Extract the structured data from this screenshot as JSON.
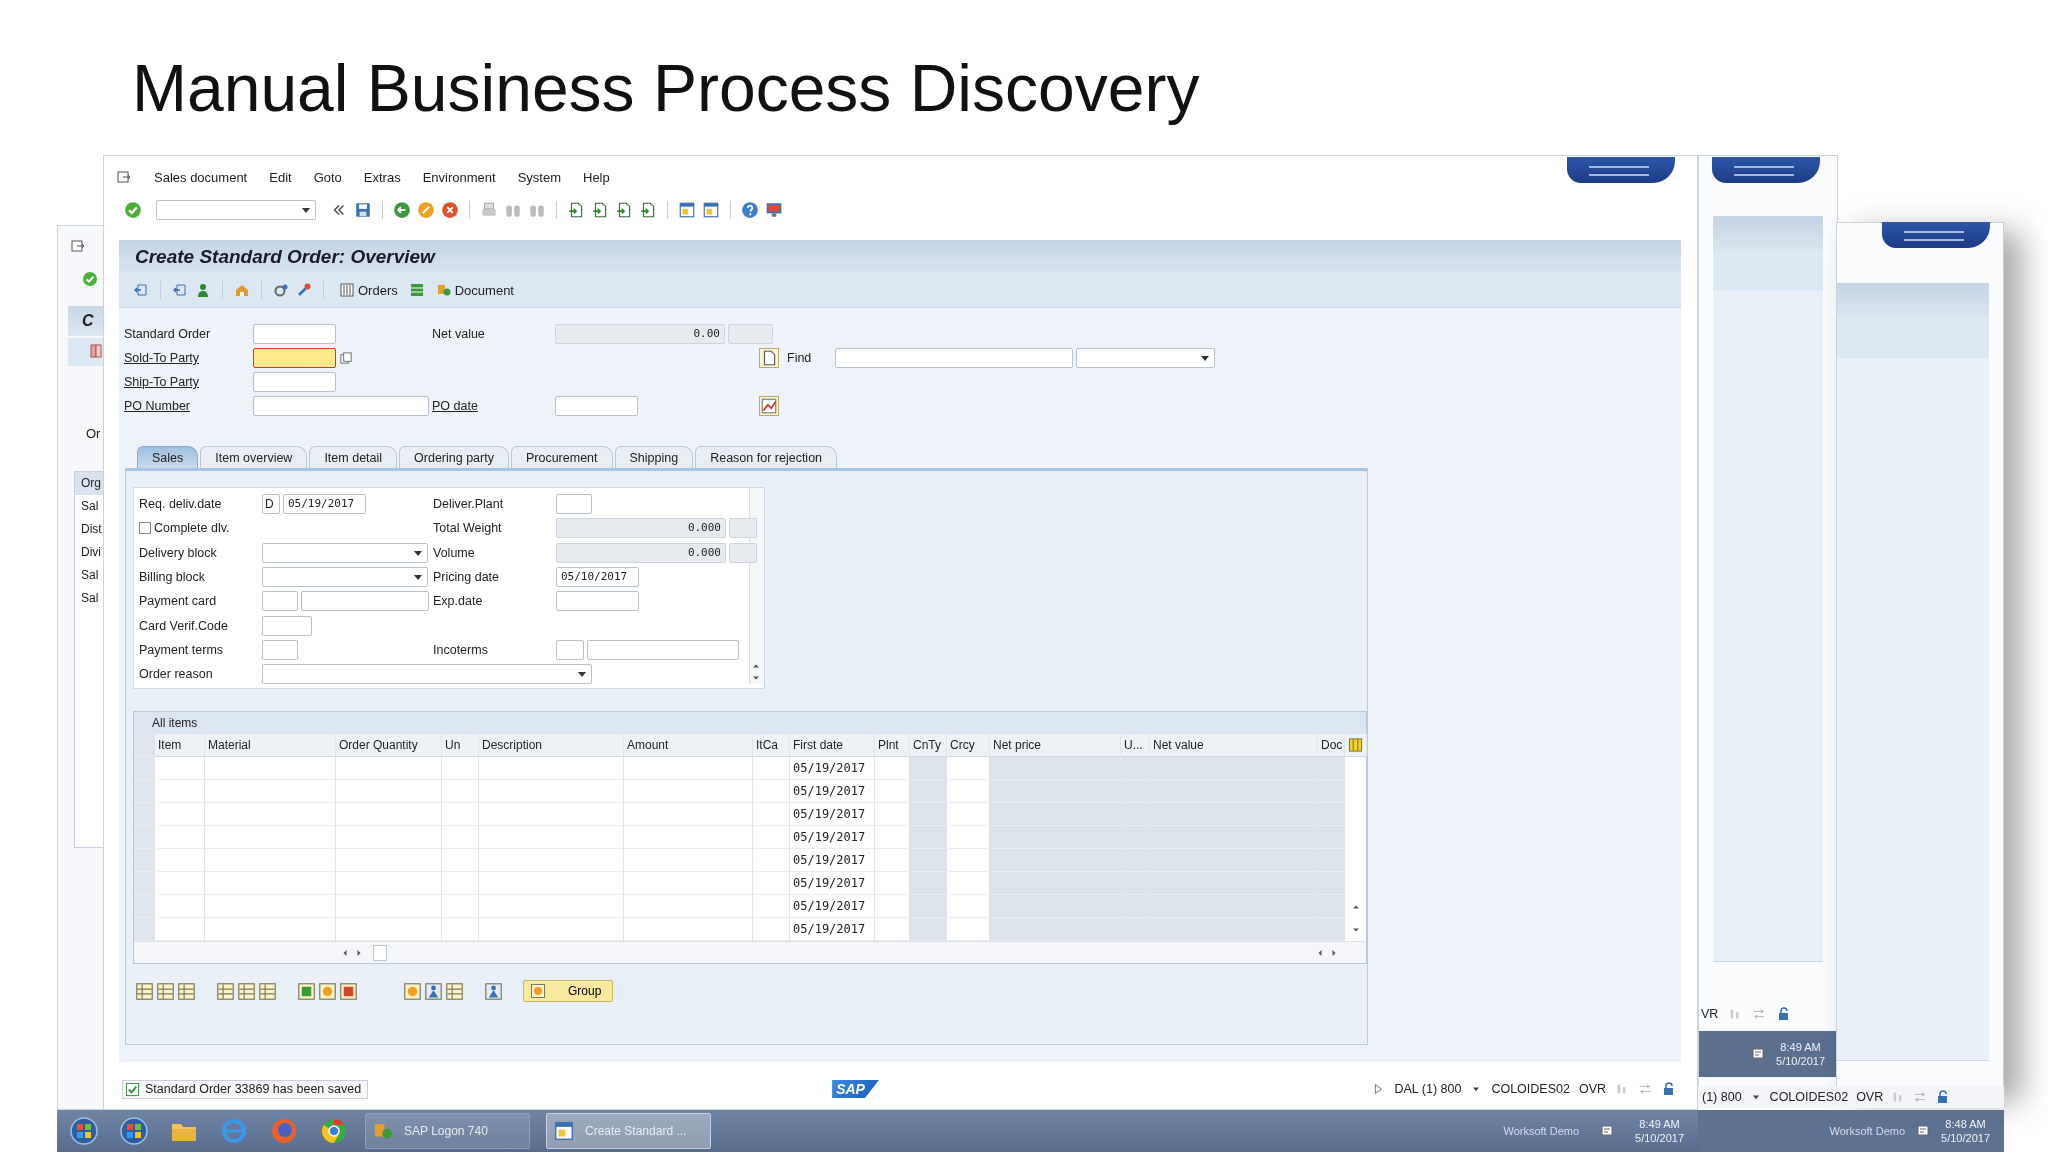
{
  "slide_title": "Manual Business Process Discovery",
  "back_window": {
    "heading": "C",
    "section_label": "Or",
    "list": [
      "Org",
      "Sal",
      "Dist",
      "Divi",
      "Sal",
      "Sal"
    ]
  },
  "main_window": {
    "menu": [
      "Sales document",
      "Edit",
      "Goto",
      "Extras",
      "Environment",
      "System",
      "Help"
    ],
    "title": "Create Standard Order: Overview",
    "app_toolbar_buttons": [
      {
        "kind": "orders",
        "label": "Orders"
      },
      {
        "kind": "document",
        "label": "Document"
      }
    ],
    "header_fields": [
      {
        "label": "Standard Order",
        "link": false,
        "focused": false
      },
      {
        "label": "Sold-To Party",
        "link": true,
        "focused": true
      },
      {
        "label": "Ship-To Party",
        "link": true,
        "focused": false
      },
      {
        "label": "PO Number",
        "link": true,
        "focused": false
      }
    ],
    "net_value": {
      "label": "Net value",
      "value": "0.00"
    },
    "find": {
      "label": "Find"
    },
    "po_date": {
      "label": "PO date",
      "link": true
    },
    "tabs": [
      {
        "label": "Sales",
        "selected": true
      },
      {
        "label": "Item overview",
        "selected": false
      },
      {
        "label": "Item detail",
        "selected": false
      },
      {
        "label": "Ordering party",
        "selected": false
      },
      {
        "label": "Procurement",
        "selected": false
      },
      {
        "label": "Shipping",
        "selected": false
      },
      {
        "label": "Reason for rejection",
        "selected": false
      }
    ],
    "sales_rows": [
      {
        "left": {
          "kind": "date",
          "label": "Req. deliv.date",
          "prefix": "D",
          "value": "05/19/2017"
        },
        "right": {
          "kind": "short",
          "label": "Deliver.Plant"
        }
      },
      {
        "left": {
          "kind": "checkbox",
          "label": "Complete dlv.",
          "checked": false
        },
        "right": {
          "kind": "readonly",
          "label": "Total Weight",
          "value": "0.000"
        }
      },
      {
        "left": {
          "kind": "dropdown",
          "label": "Delivery block"
        },
        "right": {
          "kind": "readonly",
          "label": "Volume",
          "value": "0.000"
        }
      },
      {
        "left": {
          "kind": "dropdown",
          "label": "Billing block"
        },
        "right": {
          "kind": "date",
          "label": "Pricing date",
          "value": "05/10/2017"
        }
      },
      {
        "left": {
          "kind": "pair",
          "label": "Payment card"
        },
        "right": {
          "kind": "medium",
          "label": "Exp.date"
        }
      },
      {
        "left": {
          "kind": "medium",
          "label": "Card Verif.Code"
        }
      },
      {
        "left": {
          "kind": "short",
          "label": "Payment terms"
        },
        "right": {
          "kind": "pair",
          "label": "Incoterms"
        }
      },
      {
        "left": {
          "kind": "wide-dropdown",
          "label": "Order reason"
        }
      }
    ],
    "table": {
      "title": "All items",
      "columns": [
        {
          "label": "Item",
          "readonly": false
        },
        {
          "label": "Material",
          "readonly": false
        },
        {
          "label": "Order Quantity",
          "readonly": false
        },
        {
          "label": "Un",
          "readonly": false
        },
        {
          "label": "Description",
          "readonly": false
        },
        {
          "label": "Amount",
          "readonly": false
        },
        {
          "label": "ItCa",
          "readonly": false
        },
        {
          "label": "First date",
          "readonly": false,
          "kind": "first-date"
        },
        {
          "label": "Plnt",
          "readonly": false
        },
        {
          "label": "CnTy",
          "readonly": true
        },
        {
          "label": "Crcy",
          "readonly": false
        },
        {
          "label": "Net price",
          "readonly": true
        },
        {
          "label": "U...",
          "readonly": true
        },
        {
          "label": "Net value",
          "readonly": true
        },
        {
          "label": "Doc",
          "readonly": true
        }
      ],
      "rows": [
        {
          "first_date": "05/19/2017"
        },
        {
          "first_date": "05/19/2017"
        },
        {
          "first_date": "05/19/2017"
        },
        {
          "first_date": "05/19/2017"
        },
        {
          "first_date": "05/19/2017"
        },
        {
          "first_date": "05/19/2017"
        },
        {
          "first_date": "05/19/2017"
        },
        {
          "first_date": "05/19/2017"
        }
      ]
    },
    "group_button": "Group",
    "status": {
      "message": "Standard Order 33869 has been saved",
      "logo": "SAP",
      "system": "DAL (1) 800",
      "user": "COLOIDES02",
      "mode": "OVR"
    }
  },
  "taskbar": {
    "tasks": [
      {
        "label": "SAP Logon 740",
        "selected": false
      },
      {
        "label": "Create Standard ...",
        "selected": true
      }
    ],
    "tray_label": "Worksoft Demo",
    "time": "8:49 AM",
    "date": "5/10/2017"
  },
  "right_window_a": {
    "mode": "VR",
    "time": "8:49 AM",
    "date": "5/10/2017"
  },
  "right_window_b": {
    "system": "(1) 800",
    "user": "COLOIDES02",
    "mode": "OVR",
    "tray_label": "Worksoft Demo",
    "time": "8:48 AM",
    "date": "5/10/2017"
  }
}
